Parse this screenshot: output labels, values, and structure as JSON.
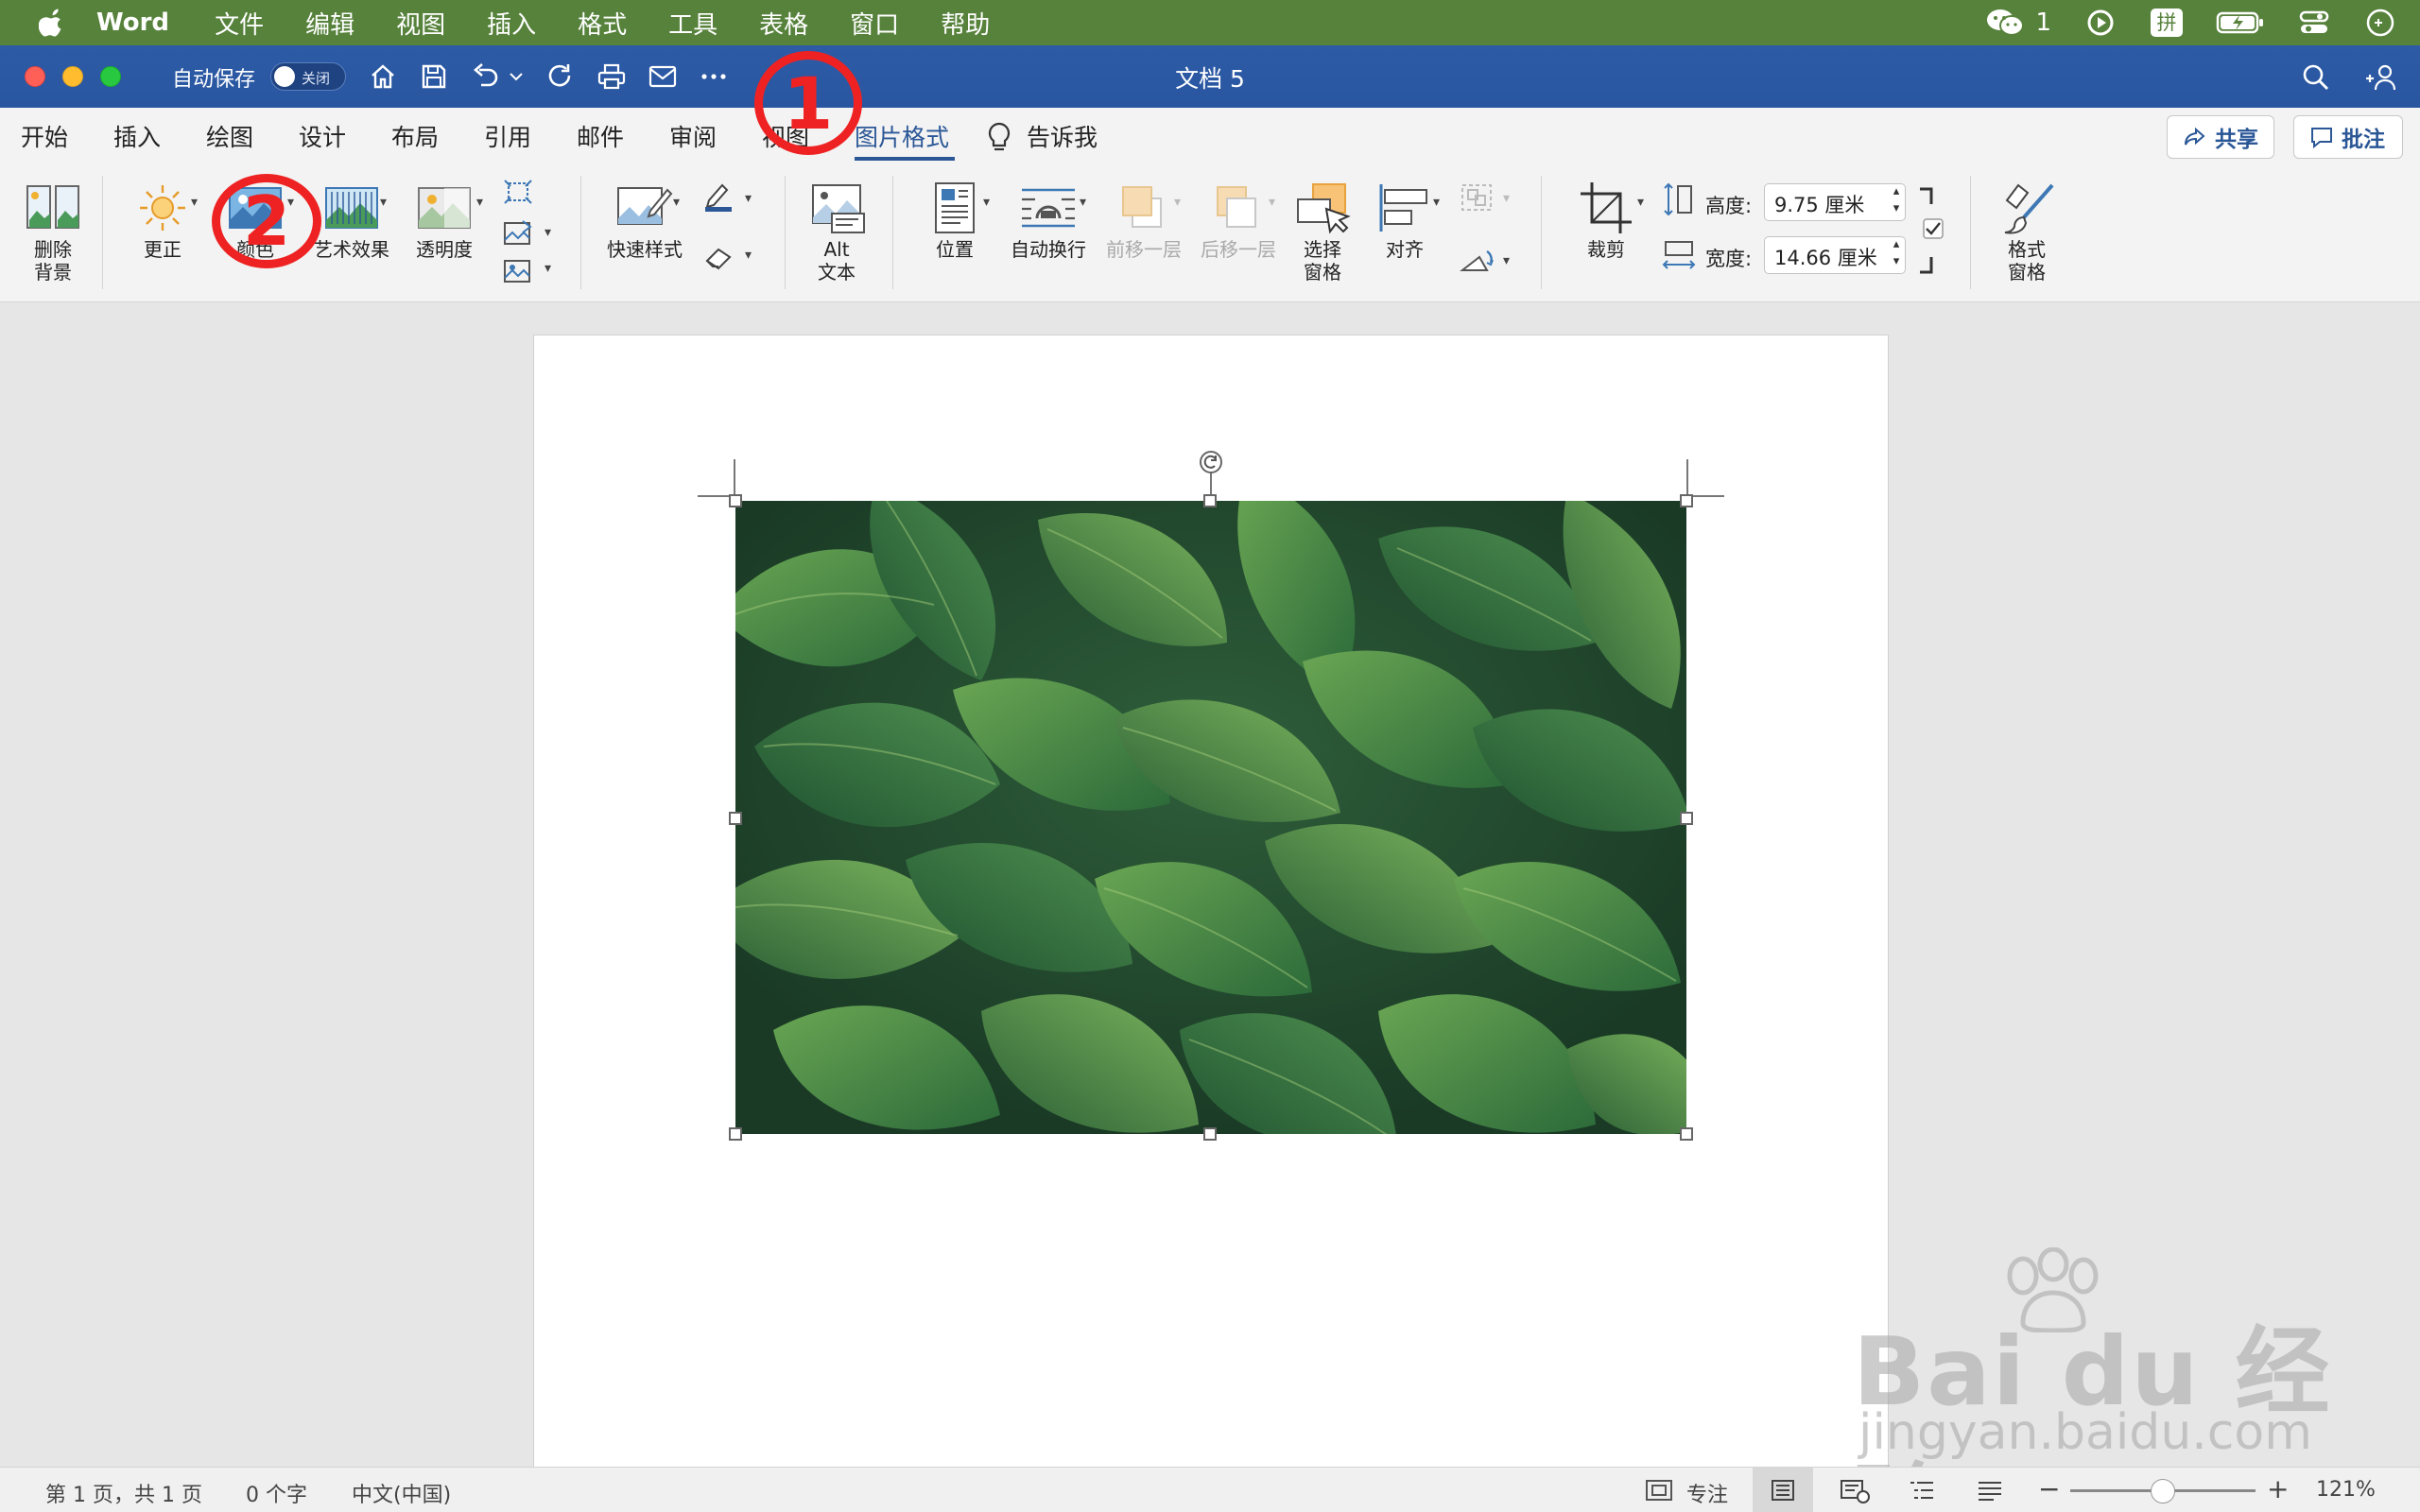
{
  "menubar": {
    "app_name": "Word",
    "items": [
      "文件",
      "编辑",
      "视图",
      "插入",
      "格式",
      "工具",
      "表格",
      "窗口",
      "帮助"
    ],
    "wechat_count": "1",
    "input_method": "拼",
    "bg_color": "#57823c"
  },
  "titlebar": {
    "autosave_label": "自动保存",
    "autosave_state": "关闭",
    "doc_title": "文档 5",
    "bg_color": "#2b5797"
  },
  "tabs": {
    "items": [
      "开始",
      "插入",
      "绘图",
      "设计",
      "布局",
      "引用",
      "邮件",
      "审阅",
      "视图",
      "图片格式",
      "告诉我"
    ],
    "active": "图片格式",
    "share_label": "共享",
    "comment_label": "批注"
  },
  "ribbon": {
    "remove_bg": [
      "删除",
      "背景"
    ],
    "corrections": "更正",
    "color": "颜色",
    "artistic": "艺术效果",
    "transparency": "透明度",
    "quick_styles": "快速样式",
    "alt_text": [
      "Alt",
      "文本"
    ],
    "position": "位置",
    "wrap_text": "自动换行",
    "bring_forward": "前移一层",
    "send_backward": "后移一层",
    "selection_pane": [
      "选择",
      "窗格"
    ],
    "align": "对齐",
    "crop": "裁剪",
    "height_label": "高度:",
    "height_value": "9.75 厘米",
    "width_label": "宽度:",
    "width_value": "14.66 厘米",
    "format_pane": [
      "格式",
      "窗格"
    ]
  },
  "statusbar": {
    "page": "第 1 页，共 1 页",
    "words": "0 个字",
    "language": "中文(中国)",
    "focus": "专注",
    "zoom": "121%",
    "zoom_level": 0.5
  },
  "annotations": [
    "1",
    "2"
  ],
  "watermark": {
    "logo": "Bai du 经验",
    "url": "jingyan.baidu.com"
  }
}
